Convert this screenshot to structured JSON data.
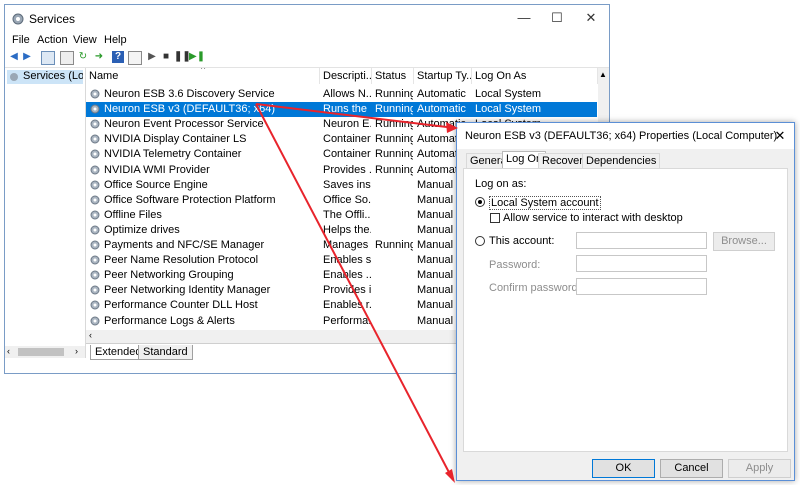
{
  "services_window": {
    "title": "Services",
    "controls": {
      "minimize": "—",
      "maximize": "☐",
      "close": "✕"
    },
    "menu": [
      "File",
      "Action",
      "View",
      "Help"
    ],
    "tree_item": "Services (Local)",
    "columns": [
      "Name",
      "Descripti...",
      "Status",
      "Startup Ty...",
      "Log On As"
    ],
    "rows": [
      {
        "name": "Neuron ESB 3.6 Discovery Service",
        "desc": "Allows N...",
        "status": "Running",
        "startup": "Automatic",
        "logon": "Local System",
        "selected": false
      },
      {
        "name": "Neuron ESB v3 (DEFAULT36; x64)",
        "desc": "Runs the ...",
        "status": "Running",
        "startup": "Automatic",
        "logon": "Local System",
        "selected": true
      },
      {
        "name": "Neuron Event Processor Service",
        "desc": "Neuron E...",
        "status": "Running",
        "startup": "Automatic",
        "logon": "Local System",
        "selected": false
      },
      {
        "name": "NVIDIA Display Container LS",
        "desc": "Container...",
        "status": "Running",
        "startup": "Automatic",
        "logon": "",
        "selected": false
      },
      {
        "name": "NVIDIA Telemetry Container",
        "desc": "Container...",
        "status": "Running",
        "startup": "Automatic",
        "logon": "",
        "selected": false
      },
      {
        "name": "NVIDIA WMI Provider",
        "desc": "Provides ...",
        "status": "Running",
        "startup": "Automatic",
        "logon": "",
        "selected": false
      },
      {
        "name": "Office  Source Engine",
        "desc": "Saves inst...",
        "status": "",
        "startup": "Manual",
        "logon": "",
        "selected": false
      },
      {
        "name": "Office Software Protection Platform",
        "desc": "Office So...",
        "status": "",
        "startup": "Manual",
        "logon": "",
        "selected": false
      },
      {
        "name": "Offline Files",
        "desc": "The Offli...",
        "status": "",
        "startup": "Manual (T",
        "logon": "",
        "selected": false
      },
      {
        "name": "Optimize drives",
        "desc": "Helps the...",
        "status": "",
        "startup": "Manual",
        "logon": "",
        "selected": false
      },
      {
        "name": "Payments and NFC/SE Manager",
        "desc": "Manages ...",
        "status": "Running",
        "startup": "Manual (T",
        "logon": "",
        "selected": false
      },
      {
        "name": "Peer Name Resolution Protocol",
        "desc": "Enables s...",
        "status": "",
        "startup": "Manual",
        "logon": "",
        "selected": false
      },
      {
        "name": "Peer Networking Grouping",
        "desc": "Enables ...",
        "status": "",
        "startup": "Manual",
        "logon": "",
        "selected": false
      },
      {
        "name": "Peer Networking Identity Manager",
        "desc": "Provides i...",
        "status": "",
        "startup": "Manual",
        "logon": "",
        "selected": false
      },
      {
        "name": "Performance Counter DLL Host",
        "desc": "Enables r...",
        "status": "",
        "startup": "Manual",
        "logon": "",
        "selected": false
      },
      {
        "name": "Performance Logs & Alerts",
        "desc": "Performa...",
        "status": "",
        "startup": "Manual",
        "logon": "",
        "selected": false
      }
    ],
    "tabs": [
      "Extended",
      "Standard"
    ]
  },
  "dialog": {
    "title": "Neuron ESB v3 (DEFAULT36; x64) Properties (Local Computer)",
    "close": "✕",
    "tabs": [
      "General",
      "Log On",
      "Recovery",
      "Dependencies"
    ],
    "log_on_as": "Log on as:",
    "local_system": "Local System account",
    "allow_desktop": "Allow service to interact with desktop",
    "this_account": "This account:",
    "browse": "Browse...",
    "password": "Password:",
    "confirm_password": "Confirm password:",
    "ok": "OK",
    "cancel": "Cancel",
    "apply": "Apply"
  },
  "colors": {
    "selection": "#0078d7",
    "arrow": "#e8242c"
  }
}
